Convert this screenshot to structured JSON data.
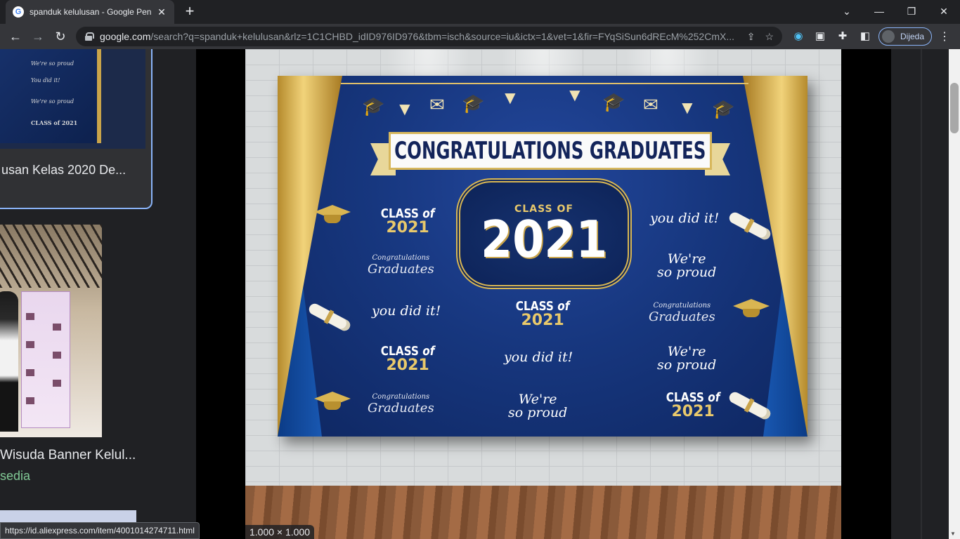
{
  "browser": {
    "tab_title": "spanduk kelulusan - Google Pene",
    "favicon": "G",
    "address_domain": "google.com",
    "address_path": "/search?q=spanduk+kelulusan&rlz=1C1CHBD_idID976ID976&tbm=isch&source=iu&ictx=1&vet=1&fir=FYqSiSun6dREcM%252CmX...",
    "profile_name": "Dijeda",
    "status_url": "https://id.aliexpress.com/item/4001014274711.html"
  },
  "results": {
    "card1_title": "usan Kelas 2020 De...",
    "card1_lines": [
      "We're so proud",
      "You did it!",
      "We're so proud",
      "CLASS of 2021"
    ],
    "card2_title": "Wisuda Banner Kelul...",
    "card2_sub": "sedia"
  },
  "preview": {
    "size_label": "1.000 × 1.000",
    "banner_title": "CONGRATULATIONS GRADUATES",
    "frame_class_of": "CLASS OF",
    "frame_year": "2021",
    "class_word": "CLASS",
    "of_word": "of",
    "year": "2021",
    "you_did_it": "you did it!",
    "were": "We're",
    "so_proud": "so proud",
    "congratulations": "Congratulations",
    "graduates": "Graduates"
  }
}
